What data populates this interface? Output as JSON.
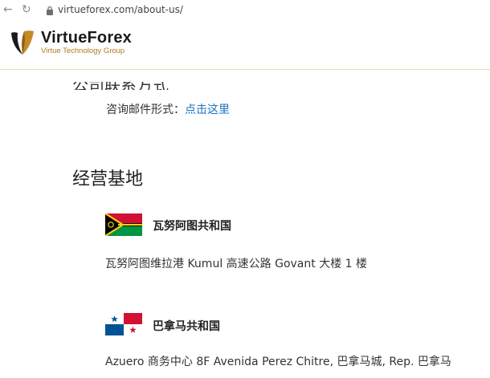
{
  "browser": {
    "url": "virtueforex.com/about-us/"
  },
  "header": {
    "brand_name": "VirtueForex",
    "tagline": "Virtue Technology Group",
    "cut_heading": "公司联系方式"
  },
  "contact": {
    "inquiry_label": "咨询邮件形式：",
    "inquiry_link": "点击这里"
  },
  "bases": {
    "title": "经营基地",
    "items": [
      {
        "country": "瓦努阿图共和国",
        "address": "瓦努阿图维拉港 Kumul 高速公路 Govant 大楼 1 楼"
      },
      {
        "country": "巴拿马共和国",
        "address": "Azuero 商务中心 8F Avenida Perez Chitre, 巴拿马城, Rep. 巴拿马"
      }
    ]
  },
  "colors": {
    "link": "#1e73be",
    "brand_gold": "#b07a1e"
  }
}
